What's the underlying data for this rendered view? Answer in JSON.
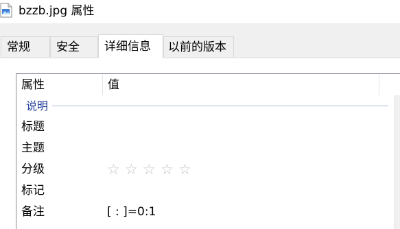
{
  "window": {
    "title": "bzzb.jpg 属性",
    "icon": "jpg-file-icon"
  },
  "tabs": [
    {
      "label": "常规",
      "active": false
    },
    {
      "label": "安全",
      "active": false
    },
    {
      "label": "详细信息",
      "active": true
    },
    {
      "label": "以前的版本",
      "active": false
    }
  ],
  "details": {
    "columns": {
      "property": "属性",
      "value": "值"
    },
    "group": "说明",
    "rows": [
      {
        "label": "标题",
        "value": ""
      },
      {
        "label": "主题",
        "value": ""
      },
      {
        "label": "分级",
        "value": "",
        "rating": 0,
        "rating_max": 5
      },
      {
        "label": "标记",
        "value": ""
      },
      {
        "label": "备注",
        "value": "[ : ]=0:1"
      }
    ],
    "star_glyph": "☆"
  },
  "colors": {
    "group_label": "#1e3b9a",
    "star_empty": "#c4c4c4"
  }
}
